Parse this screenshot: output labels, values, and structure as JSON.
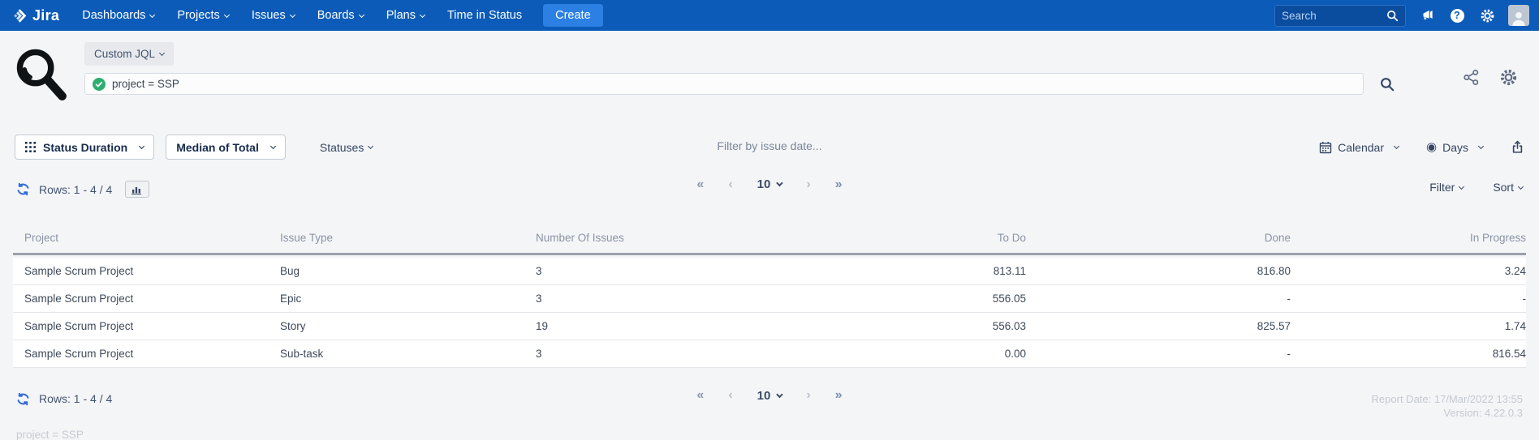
{
  "nav": {
    "brand": "Jira",
    "items": [
      {
        "label": "Dashboards",
        "chevron": true
      },
      {
        "label": "Projects",
        "chevron": true
      },
      {
        "label": "Issues",
        "chevron": true
      },
      {
        "label": "Boards",
        "chevron": true
      },
      {
        "label": "Plans",
        "chevron": true
      },
      {
        "label": "Time in Status",
        "chevron": false
      }
    ],
    "create_label": "Create",
    "search_placeholder": "Search"
  },
  "query": {
    "mode_label": "Custom JQL",
    "jql": "project = SSP"
  },
  "toolbar": {
    "report_type": "Status Duration",
    "metric": "Median of Total",
    "statuses_label": "Statuses",
    "date_filter_placeholder": "Filter by issue date...",
    "calendar_label": "Calendar",
    "unit_label": "Days"
  },
  "list_controls": {
    "rows_label": "Rows: 1 - 4 / 4",
    "filter_label": "Filter",
    "sort_label": "Sort"
  },
  "pagination": {
    "first": "«",
    "prev": "‹",
    "page_size": "10",
    "next": "›",
    "last": "»"
  },
  "table": {
    "columns": [
      {
        "label": "Project",
        "align": "left"
      },
      {
        "label": "Issue Type",
        "align": "left"
      },
      {
        "label": "Number Of Issues",
        "align": "left"
      },
      {
        "label": "To Do",
        "align": "right"
      },
      {
        "label": "Done",
        "align": "right"
      },
      {
        "label": "In Progress",
        "align": "right"
      }
    ],
    "rows": [
      [
        "Sample Scrum Project",
        "Bug",
        "3",
        "813.11",
        "816.80",
        "3.24"
      ],
      [
        "Sample Scrum Project",
        "Epic",
        "3",
        "556.05",
        "-",
        "-"
      ],
      [
        "Sample Scrum Project",
        "Story",
        "19",
        "556.03",
        "825.57",
        "1.74"
      ],
      [
        "Sample Scrum Project",
        "Sub-task",
        "3",
        "0.00",
        "-",
        "816.54"
      ]
    ]
  },
  "footer": {
    "report_date": "Report Date: 17/Mar/2022 13:55",
    "version": "Version: 4.22.0.3",
    "query_echo": "project = SSP"
  },
  "icons": {
    "help_glyph": "?",
    "eye_glyph": "◉"
  },
  "colors": {
    "nav_bg": "#0C5BB8",
    "create_bg": "#2C80E4",
    "refresh_blue": "#2F6BD8",
    "valid_green": "#2EAE6E",
    "text_dark": "#172B4D",
    "muted_header": "#8A94A4"
  }
}
